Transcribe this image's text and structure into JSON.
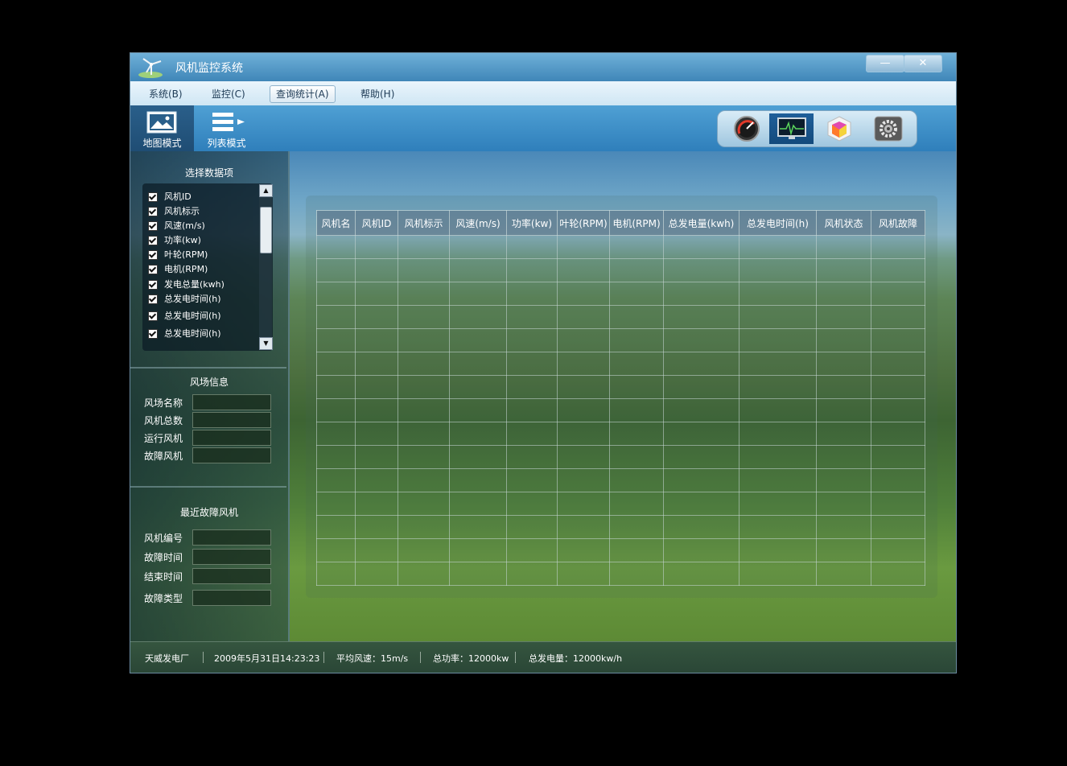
{
  "window": {
    "title": "风机监控系统",
    "minimize_glyph": "—",
    "close_glyph": "✕"
  },
  "menu": [
    "系统(B)",
    "监控(C)",
    "查询统计(A)",
    "帮助(H)"
  ],
  "modes": [
    {
      "label": "地图模式",
      "icon": "map-image-icon"
    },
    {
      "label": "列表模式",
      "icon": "list-icon"
    }
  ],
  "tools": [
    "gauge-icon",
    "monitor-waveform-icon",
    "color-cube-icon",
    "settings-gear-icon"
  ],
  "sidebar": {
    "data_items_title": "选择数据项",
    "data_items": [
      "风机ID",
      "风机标示",
      "风速(m/s)",
      "功率(kw)",
      "叶轮(RPM)",
      "电机(RPM)",
      "发电总量(kwh)",
      "总发电时间(h)",
      "总发电时间(h)",
      "总发电时间(h)"
    ],
    "scroll_up": "▲",
    "scroll_down": "▼",
    "farm_info_title": "风场信息",
    "farm_fields": [
      "风场名称",
      "风机总数",
      "运行风机",
      "故障风机"
    ],
    "recent_fault_title": "最近故障风机",
    "fault_fields": [
      "风机编号",
      "故障时间",
      "结束时间",
      "故障类型"
    ]
  },
  "table": {
    "headers": [
      "风机名",
      "风机ID",
      "风机标示",
      "风速(m/s)",
      "功率(kw)",
      "叶轮(RPM)",
      "电机(RPM)",
      "总发电量(kwh)",
      "总发电时间(h)",
      "风机状态",
      "风机故障"
    ]
  },
  "status": {
    "plant": "天威发电厂",
    "datetime": "2009年5月31日14:23:23",
    "avg_wind": "平均风速：15m/s",
    "total_power": "总功率：12000kw",
    "total_energy": "总发电量：12000kw/h"
  }
}
